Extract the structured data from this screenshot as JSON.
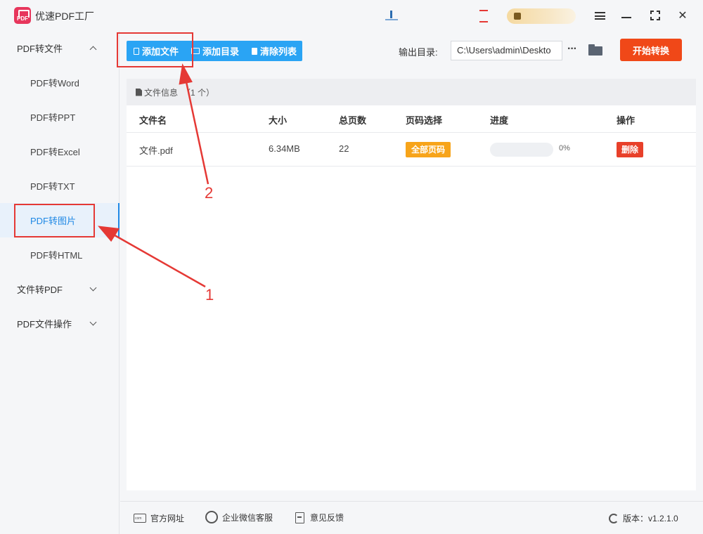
{
  "app": {
    "title": "优速PDF工厂",
    "logo_text": "PDF"
  },
  "sidebar": {
    "groups": [
      {
        "label": "PDF转文件",
        "expanded": true
      },
      {
        "label": "文件转PDF",
        "expanded": false
      },
      {
        "label": "PDF文件操作",
        "expanded": false
      }
    ],
    "items": [
      {
        "label": "PDF转Word"
      },
      {
        "label": "PDF转PPT"
      },
      {
        "label": "PDF转Excel"
      },
      {
        "label": "PDF转TXT"
      },
      {
        "label": "PDF转图片",
        "active": true
      },
      {
        "label": "PDF转HTML"
      }
    ]
  },
  "toolbar": {
    "add_file": "添加文件",
    "add_folder": "添加目录",
    "clear_list": "清除列表",
    "output_label": "输出目录:",
    "output_path": "C:\\Users\\admin\\Deskto",
    "more": "···",
    "start": "开始转换"
  },
  "file_info": {
    "label": "文件信息",
    "count": "（1 个）"
  },
  "table": {
    "headers": {
      "name": "文件名",
      "size": "大小",
      "pages": "总页数",
      "page_select": "页码选择",
      "progress": "进度",
      "action": "操作"
    },
    "rows": [
      {
        "name": "文件.pdf",
        "size": "6.34MB",
        "pages": "22",
        "page_select": "全部页码",
        "progress": 0,
        "progress_text": "0%",
        "action": "删除"
      }
    ]
  },
  "footer": {
    "website": "官方网址",
    "wechat": "企业微信客服",
    "feedback": "意见反馈",
    "version": "版本：v1.2.1.0"
  },
  "annotations": {
    "label1": "1",
    "label2": "2",
    "color": "#e53935"
  },
  "colors": {
    "accent": "#2aa4f4",
    "start": "#f04818",
    "badge": "#f7a41a",
    "delete": "#e8402a",
    "active_nav": "#1e88e5"
  }
}
